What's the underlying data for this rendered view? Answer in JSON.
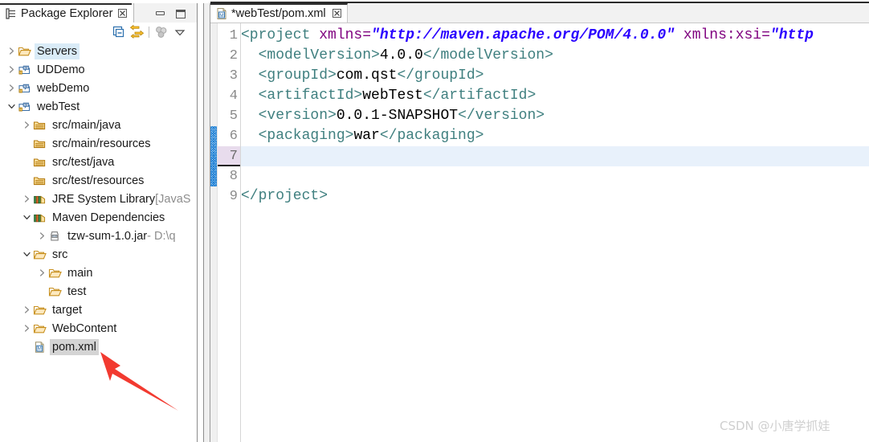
{
  "package_explorer": {
    "tab_label": "Package Explorer",
    "tab_close": "☒",
    "tab_icon": "package-explorer-icon",
    "window_buttons": {
      "minimize": "minimize-button",
      "maximize": "maximize-button"
    },
    "toolbar": [
      {
        "name": "collapse-all-icon",
        "label": "Collapse All"
      },
      {
        "name": "link-with-editor-icon",
        "label": "Link with Editor"
      },
      {
        "name": "focus-on-active-task-icon",
        "label": "Focus on Active Task"
      },
      {
        "name": "view-menu-icon",
        "label": "View Menu"
      }
    ],
    "tree": [
      {
        "indent": 0,
        "twisty": "collapsed",
        "icon": "folder-icon",
        "label": "Servers",
        "sub": "",
        "highlight": "blue"
      },
      {
        "indent": 0,
        "twisty": "collapsed",
        "icon": "maven-project-icon",
        "label": "UDDemo",
        "sub": "",
        "highlight": "none"
      },
      {
        "indent": 0,
        "twisty": "collapsed",
        "icon": "maven-project-icon",
        "label": "webDemo",
        "sub": "",
        "highlight": "none"
      },
      {
        "indent": 0,
        "twisty": "expanded",
        "icon": "maven-project-icon",
        "label": "webTest",
        "sub": "",
        "highlight": "none"
      },
      {
        "indent": 1,
        "twisty": "collapsed",
        "icon": "source-folder-icon",
        "label": "src/main/java",
        "sub": "",
        "highlight": "none"
      },
      {
        "indent": 1,
        "twisty": "none",
        "icon": "source-folder-icon",
        "label": "src/main/resources",
        "sub": "",
        "highlight": "none"
      },
      {
        "indent": 1,
        "twisty": "none",
        "icon": "source-folder-icon",
        "label": "src/test/java",
        "sub": "",
        "highlight": "none"
      },
      {
        "indent": 1,
        "twisty": "none",
        "icon": "source-folder-icon",
        "label": "src/test/resources",
        "sub": "",
        "highlight": "none"
      },
      {
        "indent": 1,
        "twisty": "collapsed",
        "icon": "library-icon",
        "label": "JRE System Library ",
        "sub": "[JavaS",
        "highlight": "none"
      },
      {
        "indent": 1,
        "twisty": "expanded",
        "icon": "library-icon",
        "label": "Maven Dependencies",
        "sub": "",
        "highlight": "none"
      },
      {
        "indent": 2,
        "twisty": "collapsed",
        "icon": "jar-icon",
        "label": "tzw-sum-1.0.jar",
        "sub": " - D:\\q",
        "highlight": "none"
      },
      {
        "indent": 1,
        "twisty": "expanded",
        "icon": "folder-icon",
        "label": "src",
        "sub": "",
        "highlight": "none"
      },
      {
        "indent": 2,
        "twisty": "collapsed",
        "icon": "folder-icon",
        "label": "main",
        "sub": "",
        "highlight": "none"
      },
      {
        "indent": 2,
        "twisty": "none",
        "icon": "folder-icon",
        "label": "test",
        "sub": "",
        "highlight": "none"
      },
      {
        "indent": 1,
        "twisty": "collapsed",
        "icon": "folder-icon",
        "label": "target",
        "sub": "",
        "highlight": "none"
      },
      {
        "indent": 1,
        "twisty": "collapsed",
        "icon": "folder-icon",
        "label": "WebContent",
        "sub": "",
        "highlight": "none"
      },
      {
        "indent": 1,
        "twisty": "none",
        "icon": "maven-pom-icon",
        "label": "pom.xml",
        "sub": "",
        "highlight": "gray"
      }
    ]
  },
  "editor": {
    "tab_label": "*webTest/pom.xml",
    "tab_close": "☒",
    "tab_icon": "maven-pom-icon",
    "current_line": 7,
    "change_bar_lines": [
      6,
      7,
      8
    ],
    "line_numbers": [
      "1",
      "2",
      "3",
      "4",
      "5",
      "6",
      "7",
      "8",
      "9"
    ],
    "lines": [
      {
        "num": "1",
        "fold": true,
        "segments": [
          {
            "t": "<project ",
            "c": "tg"
          },
          {
            "t": "xmlns=",
            "c": "at"
          },
          {
            "t": "\"http://maven.apache.org/POM/4.0.0\"",
            "c": "av"
          },
          {
            "t": " xmlns:xsi=",
            "c": "at"
          },
          {
            "t": "\"http",
            "c": "av"
          }
        ]
      },
      {
        "num": "2",
        "fold": false,
        "segments": [
          {
            "t": "  <modelVersion>",
            "c": "tg"
          },
          {
            "t": "4.0.0",
            "c": "tx"
          },
          {
            "t": "</modelVersion>",
            "c": "tg"
          }
        ]
      },
      {
        "num": "3",
        "fold": false,
        "segments": [
          {
            "t": "  <groupId>",
            "c": "tg"
          },
          {
            "t": "com.qst",
            "c": "tx"
          },
          {
            "t": "</groupId>",
            "c": "tg"
          }
        ]
      },
      {
        "num": "4",
        "fold": false,
        "segments": [
          {
            "t": "  <artifactId>",
            "c": "tg"
          },
          {
            "t": "webTest",
            "c": "tx"
          },
          {
            "t": "</artifactId>",
            "c": "tg"
          }
        ]
      },
      {
        "num": "5",
        "fold": false,
        "segments": [
          {
            "t": "  <version>",
            "c": "tg"
          },
          {
            "t": "0.0.1-SNAPSHOT",
            "c": "tx"
          },
          {
            "t": "</version>",
            "c": "tg"
          }
        ]
      },
      {
        "num": "6",
        "fold": false,
        "segments": [
          {
            "t": "  <packaging>",
            "c": "tg"
          },
          {
            "t": "war",
            "c": "tx"
          },
          {
            "t": "</packaging>",
            "c": "tg"
          }
        ]
      },
      {
        "num": "7",
        "fold": false,
        "segments": []
      },
      {
        "num": "8",
        "fold": false,
        "segments": []
      },
      {
        "num": "9",
        "fold": false,
        "segments": [
          {
            "t": "</project>",
            "c": "tg"
          }
        ]
      }
    ]
  },
  "annotation": {
    "arrow": "red-arrow-pointing-to-pom-xml",
    "color": "#f23a30"
  },
  "watermark": {
    "text": "CSDN @小唐学抓娃"
  },
  "colors": {
    "tag": "#3f7f7f",
    "attribute": "#7f007f",
    "attribute_value": "#2a00ff",
    "current_line_bg": "#e8f1fb",
    "selection_blue": "#d9ebf7",
    "selection_gray": "#d4d4d4",
    "arrow_red": "#f23a30"
  }
}
